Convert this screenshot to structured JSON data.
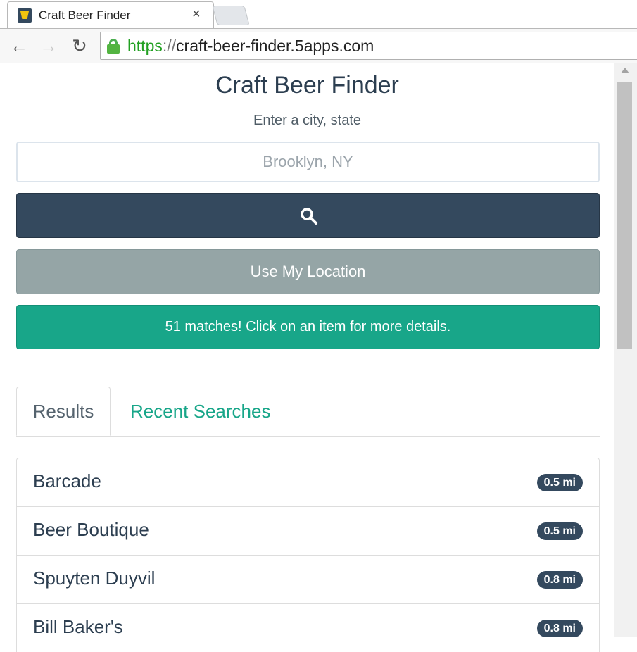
{
  "browser": {
    "tab_title": "Craft Beer Finder",
    "url_scheme": "https",
    "url_sep": "://",
    "url_host": "craft-beer-finder.5apps.com"
  },
  "app": {
    "title": "Craft Beer Finder",
    "subtitle": "Enter a city, state",
    "search_placeholder": "Brooklyn, NY",
    "location_button": "Use My Location",
    "alert": "51 matches! Click on an item for more details."
  },
  "tabs": {
    "results": "Results",
    "recent": "Recent Searches"
  },
  "results": [
    {
      "name": "Barcade",
      "distance": "0.5 mi"
    },
    {
      "name": "Beer Boutique",
      "distance": "0.5 mi"
    },
    {
      "name": "Spuyten Duyvil",
      "distance": "0.8 mi"
    },
    {
      "name": "Bill Baker's",
      "distance": "0.8 mi"
    }
  ],
  "colors": {
    "primary": "#34495e",
    "secondary": "#95a5a6",
    "success": "#18a689"
  }
}
